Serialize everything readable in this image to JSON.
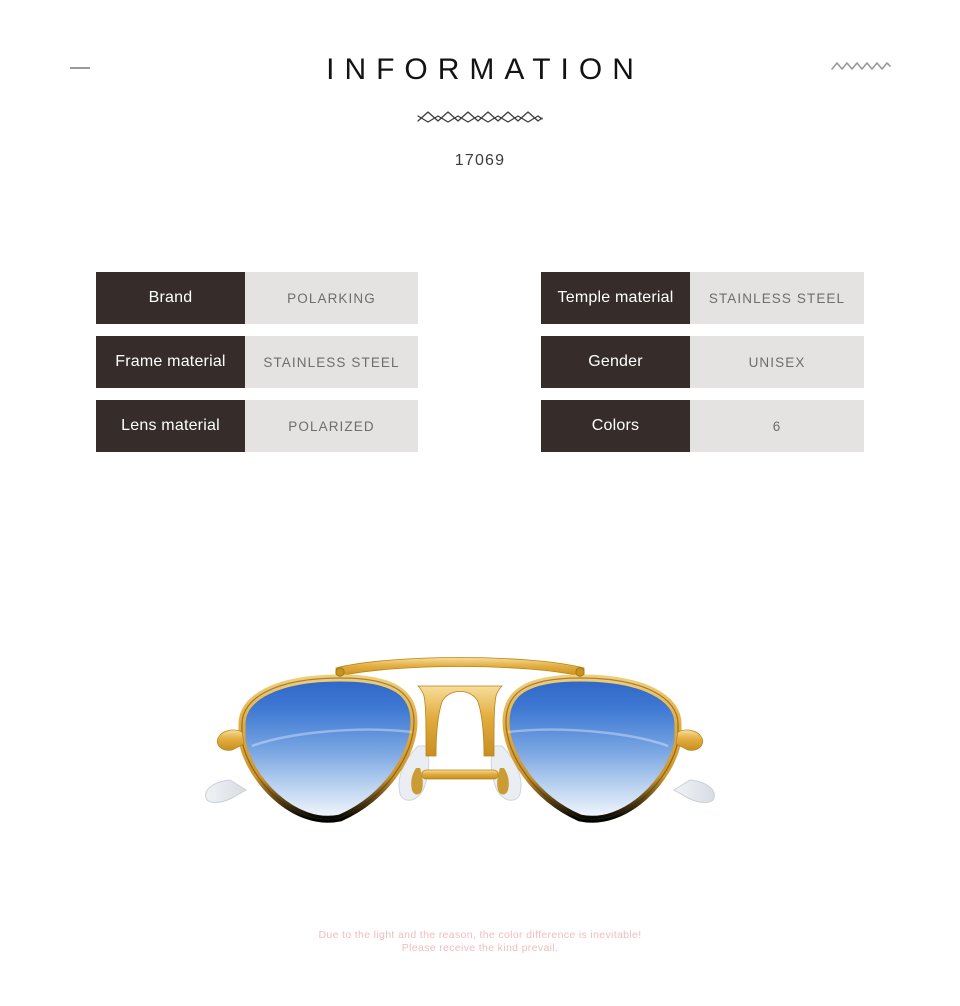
{
  "header": {
    "title": "INFORMATION",
    "sku": "17069",
    "dash_icon": "dash-icon",
    "right_zigzag_icon": "zigzag-icon",
    "center_zigzag_icon": "double-zigzag-divider-icon"
  },
  "specs": {
    "left": [
      {
        "key": "Brand",
        "value": "POLARKING"
      },
      {
        "key": "Frame material",
        "value": "STAINLESS STEEL"
      },
      {
        "key": "Lens material",
        "value": "POLARIZED"
      }
    ],
    "right": [
      {
        "key": "Temple material",
        "value": "STAINLESS STEEL"
      },
      {
        "key": "Gender",
        "value": "UNISEX"
      },
      {
        "key": "Colors",
        "value": "6"
      }
    ]
  },
  "product": {
    "image_name": "aviator-sunglasses-photo",
    "frame_color": "#e0aa3e",
    "lens_color_top": "#3a73cf",
    "lens_color_bottom": "#f2f6fc"
  },
  "disclaimer": {
    "line1": "Due to the light and the reason, the color difference is inevitable!",
    "line2": "Please receive the kind prevail."
  },
  "colors": {
    "key_cell_bg": "#362d2a",
    "value_cell_bg": "#e4e3e1",
    "value_text": "#6d6d6d",
    "title_text": "#131313",
    "disclaimer_text": "#f2bcbc",
    "ornament": "#9a9a9a"
  }
}
